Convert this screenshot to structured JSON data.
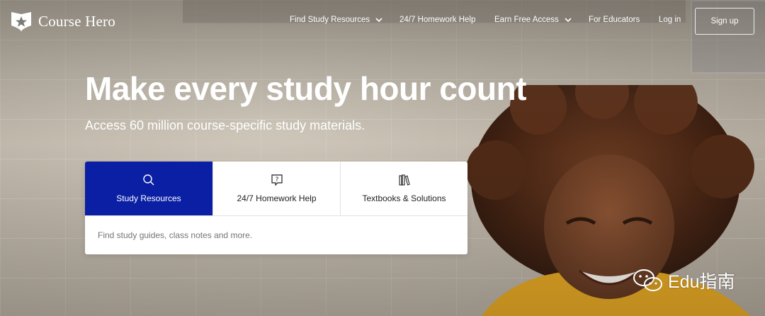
{
  "nav": {
    "logo_text": "Course Hero",
    "items": [
      {
        "label": "Find Study Resources",
        "has_dropdown": true
      },
      {
        "label": "24/7 Homework Help",
        "has_dropdown": false
      },
      {
        "label": "Earn Free Access",
        "has_dropdown": true
      },
      {
        "label": "For Educators",
        "has_dropdown": false
      },
      {
        "label": "Log in",
        "has_dropdown": false
      }
    ],
    "signup_label": "Sign up"
  },
  "hero": {
    "headline": "Make every study hour count",
    "subhead": "Access 60 million course-specific study materials."
  },
  "search": {
    "tabs": [
      {
        "label": "Study Resources",
        "icon": "search-icon",
        "active": true
      },
      {
        "label": "24/7 Homework Help",
        "icon": "question-bubble-icon",
        "active": false
      },
      {
        "label": "Textbooks & Solutions",
        "icon": "books-icon",
        "active": false
      }
    ],
    "placeholder": "Find study guides, class notes and more."
  },
  "watermark": {
    "text": "Edu指南",
    "icon": "wechat-icon"
  },
  "colors": {
    "active_tab": "#0a1fa3",
    "text_white": "#ffffff"
  }
}
